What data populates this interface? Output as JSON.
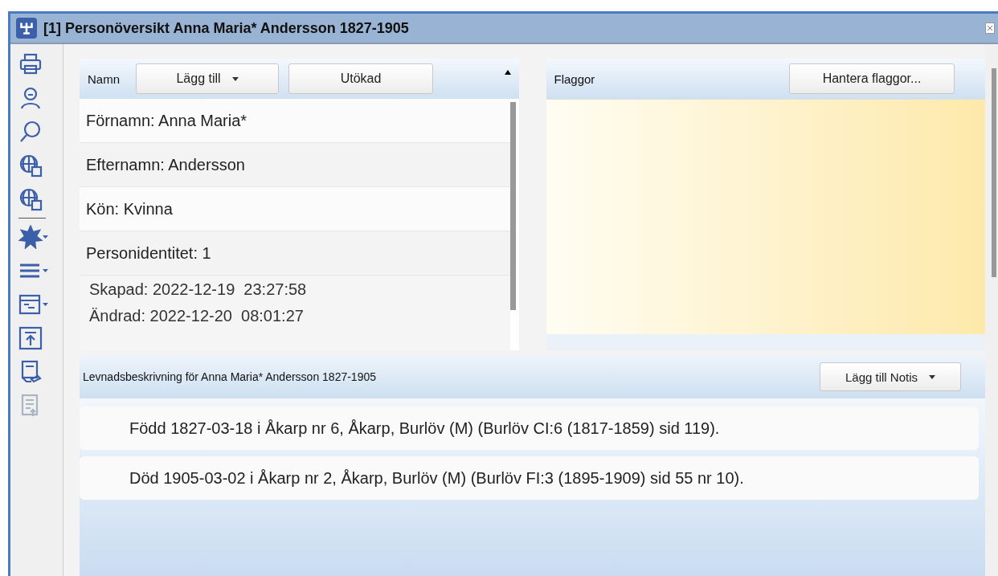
{
  "window": {
    "title": "[1] Personöversikt Anna Maria* Andersson 1827-1905"
  },
  "toolbar": [
    {
      "disabled": false,
      "dropdown": false
    },
    {
      "disabled": false,
      "dropdown": false
    },
    {
      "disabled": false,
      "dropdown": false
    },
    {
      "disabled": false,
      "dropdown": false
    },
    {
      "disabled": false,
      "dropdown": false
    },
    {
      "disabled": false,
      "dropdown": true
    },
    {
      "disabled": false,
      "dropdown": true
    },
    {
      "disabled": false,
      "dropdown": true
    },
    {
      "disabled": false,
      "dropdown": false
    },
    {
      "disabled": false,
      "dropdown": false
    },
    {
      "disabled": true,
      "dropdown": false
    }
  ],
  "name_panel": {
    "label": "Namn",
    "add_button": "Lägg till",
    "extended_button": "Utökad",
    "fields": [
      "Förnamn: Anna Maria*",
      "Efternamn: Andersson",
      "Kön: Kvinna",
      "Personidentitet: 1"
    ],
    "meta": [
      "Skapad: 2022-12-19  23:27:58",
      "Ändrad: 2022-12-20  08:01:27"
    ]
  },
  "flags_panel": {
    "label": "Flaggor",
    "manage_button": "Hantera flaggor..."
  },
  "description": {
    "title": "Levnadsbeskrivning för Anna Maria* Andersson 1827-1905",
    "add_note_button": "Lägg till Notis",
    "entries": [
      "Född 1827-03-18 i Åkarp nr 6, Åkarp, Burlöv (M) (Burlöv CI:6 (1817-1859) sid 119).",
      "Död 1905-03-02 i Åkarp nr 2, Åkarp, Burlöv (M) (Burlöv FI:3 (1895-1909) sid 55 nr 10)."
    ]
  }
}
